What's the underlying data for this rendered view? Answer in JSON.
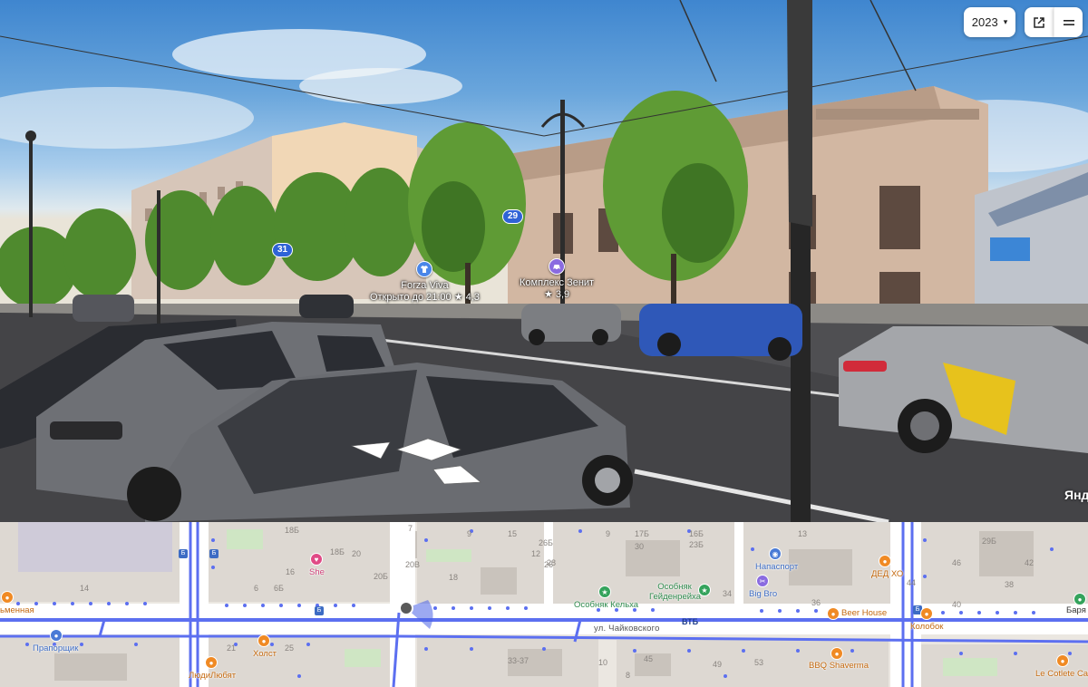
{
  "toolbar": {
    "year": "2023",
    "year_caret": "▾"
  },
  "panorama": {
    "pois": [
      {
        "name": "Forza Viva",
        "detail": "Открыто до 21:00 ★ 4,3",
        "icon": "shirt-icon",
        "color": "#4a86e8"
      },
      {
        "name": "Комплекс Зенит",
        "detail": "★ 3,9",
        "icon": "car-icon",
        "color": "#8a6be0"
      }
    ],
    "buses": [
      "31",
      "29"
    ],
    "watermark": "Янд"
  },
  "map": {
    "house_numbers": [
      "18Б",
      "20",
      "16",
      "6Б",
      "20Б",
      "20В",
      "18",
      "14",
      "12",
      "26",
      "26Б",
      "28",
      "30",
      "34",
      "36",
      "40",
      "38",
      "42",
      "44",
      "46",
      "21",
      "25",
      "33-37",
      "45",
      "49",
      "53",
      "6",
      "7",
      "17Б",
      "23Б",
      "9",
      "15",
      "16Б",
      "13",
      "29Б",
      "9",
      "8",
      "10"
    ],
    "street": "ул. Чайковского",
    "bank": "ВТБ",
    "places": [
      {
        "label": "She",
        "color": "pink"
      },
      {
        "label": "Особняк Кельха",
        "color": "green"
      },
      {
        "label": "Особняк Гейденрейха",
        "color": "green"
      },
      {
        "label": "Big Bro",
        "color": "blue"
      },
      {
        "label": "Напаспорт",
        "color": "blue"
      },
      {
        "label": "ДЕД ХО",
        "color": "orange"
      },
      {
        "label": "Beer House",
        "color": "orange"
      },
      {
        "label": "Колобок",
        "color": "orange"
      },
      {
        "label": "BBQ Shaverma",
        "color": "orange"
      },
      {
        "label": "Холст",
        "color": "orange"
      },
      {
        "label": "ЛюдиЛюбят",
        "color": "orange"
      },
      {
        "label": "Прапорщик",
        "color": "blue"
      },
      {
        "label": "ьменная",
        "color": "orange"
      },
      {
        "label": "Le Cotlete Caf",
        "color": "orange"
      },
      {
        "label": "Баря",
        "color": "dark"
      }
    ],
    "colors": {
      "route": "#5c6ff0",
      "road": "#ffffff",
      "block": "#ddd8d2",
      "park": "#cfe6c4"
    }
  }
}
